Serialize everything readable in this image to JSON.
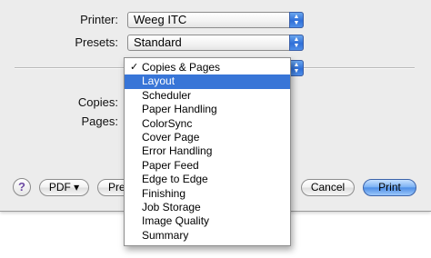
{
  "printer": {
    "label": "Printer:",
    "value": "Weeg ITC"
  },
  "presets": {
    "label": "Presets:",
    "value": "Standard"
  },
  "settings_fields": {
    "copies_label": "Copies:",
    "pages_label": "Pages:"
  },
  "panel_menu": {
    "checked_item": "Copies & Pages",
    "highlighted_item": "Layout",
    "items": [
      "Copies & Pages",
      "Layout",
      "Scheduler",
      "Paper Handling",
      "ColorSync",
      "Cover Page",
      "Error Handling",
      "Paper Feed",
      "Edge to Edge",
      "Finishing",
      "Job Storage",
      "Image Quality",
      "Summary"
    ]
  },
  "buttons": {
    "help": "?",
    "pdf": "PDF ▾",
    "preview_partial": "Prev",
    "cancel": "Cancel",
    "print": "Print"
  },
  "icons": {
    "popup_arrows": "up-down-chevrons-icon",
    "checkmark": "checkmark-icon",
    "help": "help-icon"
  },
  "colors": {
    "accent_blue": "#3875d7",
    "dialog_background": "#ececec"
  }
}
